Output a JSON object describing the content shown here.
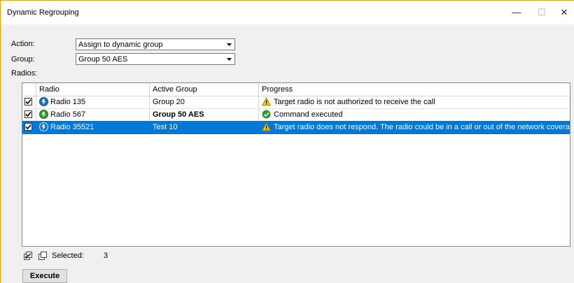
{
  "window": {
    "title": "Dynamic Regrouping"
  },
  "form": {
    "action_label": "Action:",
    "action_value": "Assign to dynamic group",
    "group_label": "Group:",
    "group_value": "Group 50 AES",
    "radios_label": "Radios:"
  },
  "table": {
    "columns": [
      "Radio",
      "Active Group",
      "Progress"
    ],
    "rows": [
      {
        "checked": true,
        "radio": "Radio 135",
        "radio_icon": "radio-unit-blue-icon",
        "group": "Group 20",
        "group_bold": false,
        "status_icon": "warning-icon",
        "progress": "Target radio is not authorized to receive the call",
        "selected": false
      },
      {
        "checked": true,
        "radio": "Radio 567",
        "radio_icon": "radio-unit-green-icon",
        "group": "Group 50 AES",
        "group_bold": true,
        "status_icon": "success-check-icon",
        "progress": "Command executed",
        "selected": false
      },
      {
        "checked": true,
        "radio": "Radio 35521",
        "radio_icon": "radio-unit-blue-icon",
        "group": "Test 10",
        "group_bold": false,
        "status_icon": "warning-icon",
        "progress": "Target radio does not respond. The radio could be in a call or out of the network coverage",
        "selected": true
      }
    ]
  },
  "footer": {
    "selected_label": "Selected:",
    "selected_count": "3",
    "execute_label": "Execute"
  },
  "colors": {
    "selection": "#0078d7",
    "warning": "#f2c200",
    "success": "#2f9b2f",
    "radio_blue": "#1e73be",
    "radio_green": "#3a9a2e"
  }
}
